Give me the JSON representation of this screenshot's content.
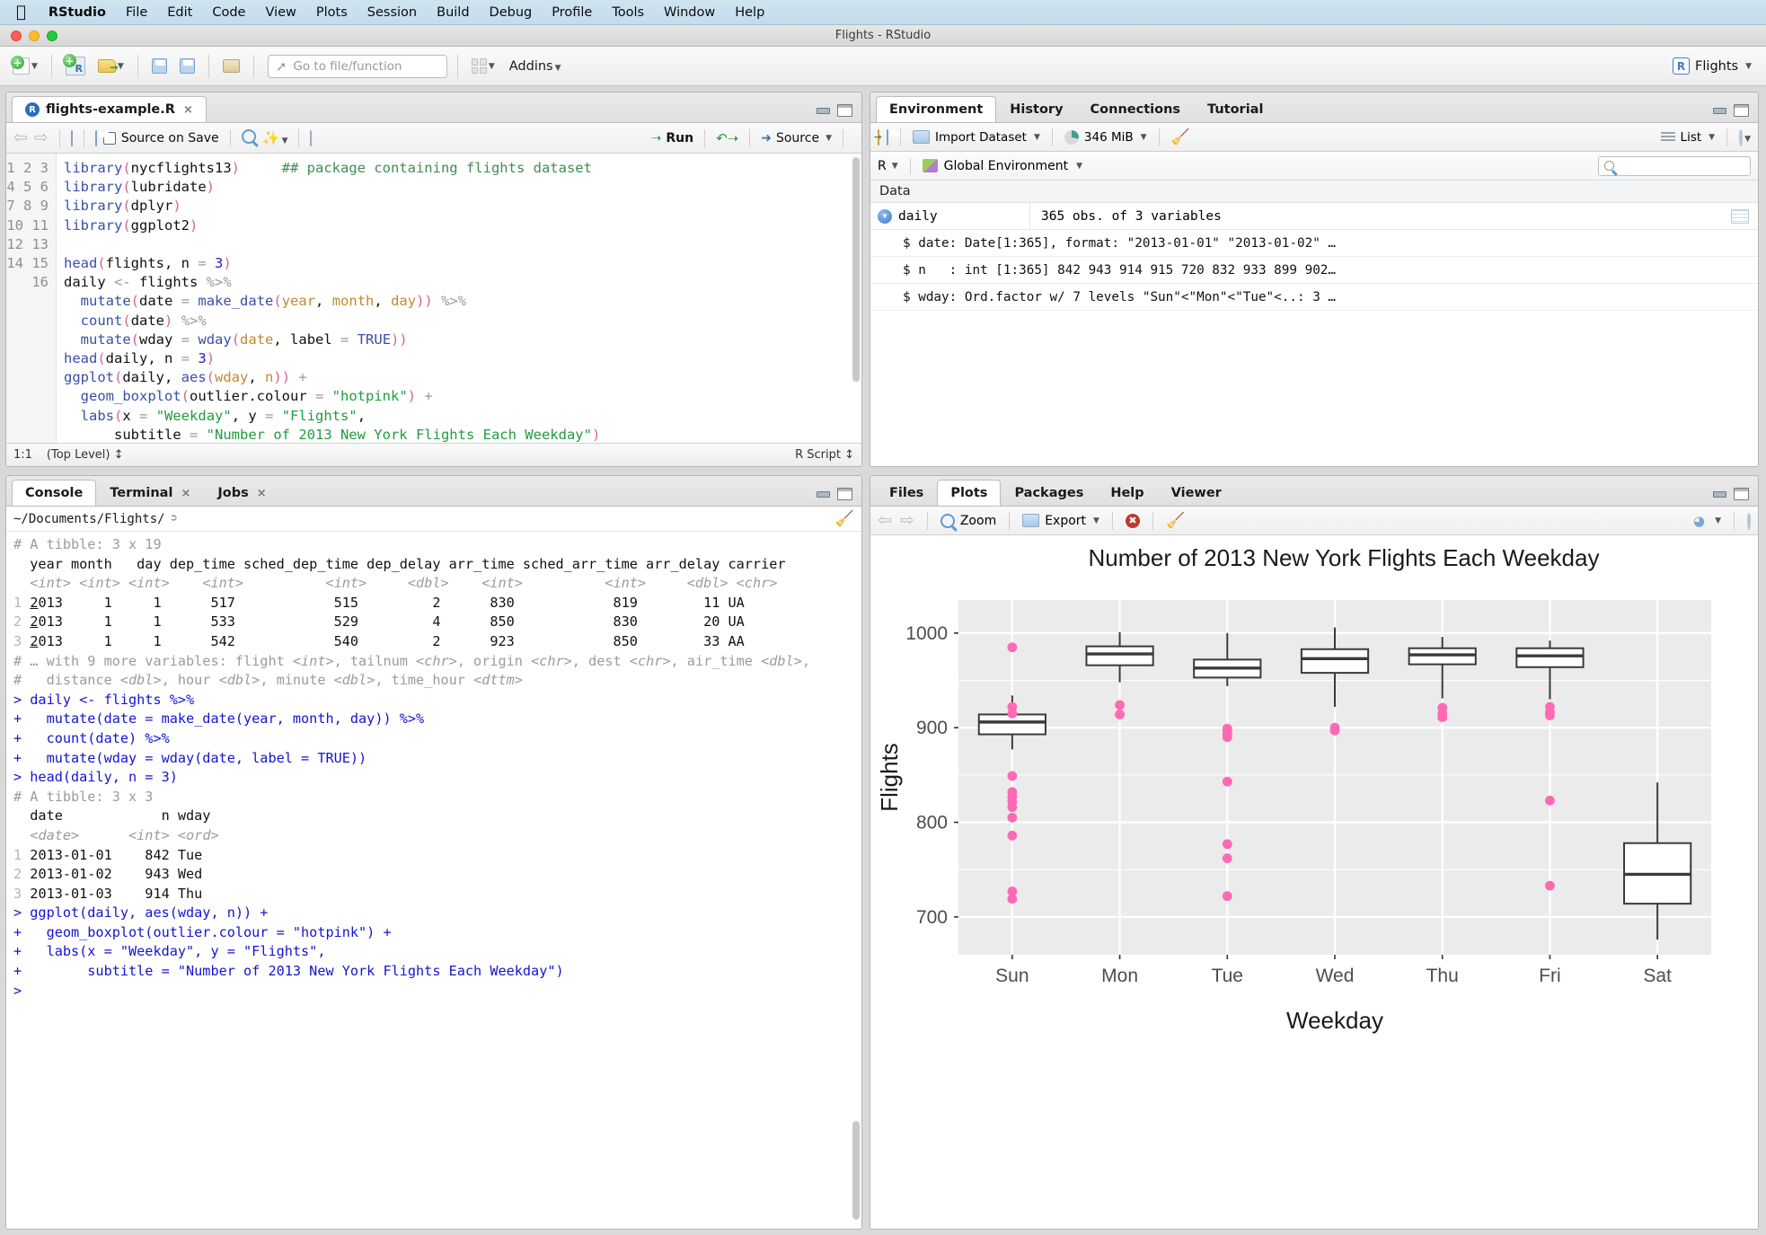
{
  "menubar": {
    "apple": "apple-logo",
    "items": [
      "RStudio",
      "File",
      "Edit",
      "Code",
      "View",
      "Plots",
      "Session",
      "Build",
      "Debug",
      "Profile",
      "Tools",
      "Window",
      "Help"
    ]
  },
  "window": {
    "title": "Flights - RStudio"
  },
  "toolbar": {
    "goto_placeholder": "Go to file/function",
    "addins": "Addins",
    "project": "Flights",
    "project_badge": "R"
  },
  "source_pane": {
    "tab": "flights-example.R",
    "tab_close": "×",
    "source_on_save": "Source on Save",
    "run": "Run",
    "source": "Source",
    "status_position": "1:1",
    "status_scope": "(Top Level) ↕",
    "status_type": "R Script ↕",
    "lines": [
      {
        "n": 1,
        "html": "<span class='k-fn'>library</span><span class='k-par'>(</span>nycflights13<span class='k-par'>)</span>     <span class='k-com'>## package containing flights dataset</span>"
      },
      {
        "n": 2,
        "html": "<span class='k-fn'>library</span><span class='k-par'>(</span>lubridate<span class='k-par'>)</span>"
      },
      {
        "n": 3,
        "html": "<span class='k-fn'>library</span><span class='k-par'>(</span>dplyr<span class='k-par'>)</span>"
      },
      {
        "n": 4,
        "html": "<span class='k-fn'>library</span><span class='k-par'>(</span>ggplot2<span class='k-par'>)</span>"
      },
      {
        "n": 5,
        "html": ""
      },
      {
        "n": 6,
        "html": "<span class='k-fn'>head</span><span class='k-par'>(</span>flights, n <span class='k-op'>=</span> <span class='k-num'>3</span><span class='k-par'>)</span>"
      },
      {
        "n": 7,
        "html": "daily <span class='k-op'>&lt;-</span> flights <span class='k-op'>%&gt;%</span>"
      },
      {
        "n": 8,
        "html": "  <span class='k-fn'>mutate</span><span class='k-par'>(</span><span class='k-id'>date</span> <span class='k-op'>=</span> <span class='k-fn'>make_date</span><span class='k-par'>(</span><span class='k-arg'>year</span>, <span class='k-arg'>month</span>, <span class='k-arg'>day</span><span class='k-par'>))</span> <span class='k-op'>%&gt;%</span>"
      },
      {
        "n": 9,
        "html": "  <span class='k-fn'>count</span><span class='k-par'>(</span><span class='k-id'>date</span><span class='k-par'>)</span> <span class='k-op'>%&gt;%</span>"
      },
      {
        "n": 10,
        "html": "  <span class='k-fn'>mutate</span><span class='k-par'>(</span><span class='k-id'>wday</span> <span class='k-op'>=</span> <span class='k-fn'>wday</span><span class='k-par'>(</span><span class='k-arg'>date</span>, label <span class='k-op'>=</span> <span class='k-kw'>TRUE</span><span class='k-par'>))</span>"
      },
      {
        "n": 11,
        "html": "<span class='k-fn'>head</span><span class='k-par'>(</span>daily, n <span class='k-op'>=</span> <span class='k-num'>3</span><span class='k-par'>)</span>"
      },
      {
        "n": 12,
        "html": "<span class='k-fn'>ggplot</span><span class='k-par'>(</span>daily, <span class='k-fn'>aes</span><span class='k-par'>(</span><span class='k-arg'>wday</span>, <span class='k-arg'>n</span><span class='k-par'>))</span> <span class='k-op'>+</span>"
      },
      {
        "n": 13,
        "html": "  <span class='k-fn'>geom_boxplot</span><span class='k-par'>(</span>outlier.colour <span class='k-op'>=</span> <span class='k-str'>\"hotpink\"</span><span class='k-par'>)</span> <span class='k-op'>+</span>"
      },
      {
        "n": 14,
        "html": "  <span class='k-fn'>labs</span><span class='k-par'>(</span>x <span class='k-op'>=</span> <span class='k-str'>\"Weekday\"</span>, y <span class='k-op'>=</span> <span class='k-str'>\"Flights\"</span>,"
      },
      {
        "n": 15,
        "html": "      subtitle <span class='k-op'>=</span> <span class='k-str'>\"Number of 2013 New York Flights Each Weekday\"</span><span class='k-par'>)</span>"
      },
      {
        "n": 16,
        "html": ""
      }
    ]
  },
  "console_pane": {
    "tabs": [
      "Console",
      "Terminal",
      "Jobs"
    ],
    "active_tab": "Console",
    "path": "~/Documents/Flights/",
    "lines": [
      {
        "html": "<span class='c-dim'># A tibble: 3 x 19</span>"
      },
      {
        "html": "  year month   day dep_time sched_dep_time dep_delay arr_time sched_arr_time arr_delay carrier"
      },
      {
        "html": "  <span class='c-it'>&lt;int&gt; &lt;int&gt; &lt;int&gt;    &lt;int&gt;          &lt;int&gt;     &lt;dbl&gt;    &lt;int&gt;          &lt;int&gt;     &lt;dbl&gt; &lt;chr&gt;</span>"
      },
      {
        "html": "<span class='c-idx'>1</span> <u>2</u>013     1     1      517            515         2      830            819        11 UA"
      },
      {
        "html": "<span class='c-idx'>2</span> <u>2</u>013     1     1      533            529         4      850            830        20 UA"
      },
      {
        "html": "<span class='c-idx'>3</span> <u>2</u>013     1     1      542            540         2      923            850        33 AA"
      },
      {
        "html": "<span class='c-dim'># … with 9 more variables: flight <i>&lt;int&gt;</i>, tailnum <i>&lt;chr&gt;</i>, origin <i>&lt;chr&gt;</i>, dest <i>&lt;chr&gt;</i>, air_time <i>&lt;dbl&gt;</i>,</span>"
      },
      {
        "html": "<span class='c-dim'>#   distance <i>&lt;dbl&gt;</i>, hour <i>&lt;dbl&gt;</i>, minute <i>&lt;dbl&gt;</i>, time_hour <i>&lt;dttm&gt;</i></span>"
      },
      {
        "html": "<span class='c-cmd'>&gt; daily &lt;- flights %&gt;%</span>"
      },
      {
        "html": "<span class='c-cmd'>+   mutate(date = make_date(year, month, day)) %&gt;%</span>"
      },
      {
        "html": "<span class='c-cmd'>+   count(date) %&gt;%</span>"
      },
      {
        "html": "<span class='c-cmd'>+   mutate(wday = wday(date, label = TRUE))</span>"
      },
      {
        "html": "<span class='c-cmd'>&gt; head(daily, n = 3)</span>"
      },
      {
        "html": "<span class='c-dim'># A tibble: 3 x 3</span>"
      },
      {
        "html": "  date            n wday"
      },
      {
        "html": "  <span class='c-it'>&lt;date&gt;      &lt;int&gt; &lt;ord&gt;</span>"
      },
      {
        "html": "<span class='c-idx'>1</span> 2013-01-01    842 Tue"
      },
      {
        "html": "<span class='c-idx'>2</span> 2013-01-02    943 Wed"
      },
      {
        "html": "<span class='c-idx'>3</span> 2013-01-03    914 Thu"
      },
      {
        "html": "<span class='c-cmd'>&gt; ggplot(daily, aes(wday, n)) +</span>"
      },
      {
        "html": "<span class='c-cmd'>+   geom_boxplot(outlier.colour = \"hotpink\") +</span>"
      },
      {
        "html": "<span class='c-cmd'>+   labs(x = \"Weekday\", y = \"Flights\",</span>"
      },
      {
        "html": "<span class='c-cmd'>+        subtitle = \"Number of 2013 New York Flights Each Weekday\")</span>"
      },
      {
        "html": "<span class='c-cmd'>&gt; </span>"
      }
    ]
  },
  "environment_pane": {
    "tabs": [
      "Environment",
      "History",
      "Connections",
      "Tutorial"
    ],
    "active_tab": "Environment",
    "import_dataset": "Import Dataset",
    "memory": "346 MiB",
    "view_mode": "List",
    "language": "R",
    "scope": "Global Environment",
    "search_placeholder": "",
    "section_label": "Data",
    "objects": [
      {
        "name": "daily",
        "summary": "365 obs. of 3 variables",
        "fields": [
          "$ date: Date[1:365], format: \"2013-01-01\" \"2013-01-02\" …",
          "$ n   : int [1:365] 842 943 914 915 720 832 933 899 902…",
          "$ wday: Ord.factor w/ 7 levels \"Sun\"<\"Mon\"<\"Tue\"<..: 3 …"
        ]
      }
    ]
  },
  "plots_pane": {
    "tabs": [
      "Files",
      "Plots",
      "Packages",
      "Help",
      "Viewer"
    ],
    "active_tab": "Plots",
    "zoom": "Zoom",
    "export": "Export"
  },
  "chart_data": {
    "type": "boxplot",
    "title": "Number of 2013 New York Flights Each Weekday",
    "xlabel": "Weekday",
    "ylabel": "Flights",
    "categories": [
      "Sun",
      "Mon",
      "Tue",
      "Wed",
      "Thu",
      "Fri",
      "Sat"
    ],
    "yticks": [
      700,
      800,
      900,
      1000
    ],
    "ylim": [
      660,
      1035
    ],
    "grid": true,
    "outlier_colour": "#ff69b4",
    "panel_bg": "#ebebeb",
    "boxes": [
      {
        "cat": "Sun",
        "lower_whisker": 877,
        "q1": 893,
        "median": 906,
        "q3": 914,
        "upper_whisker": 934,
        "outliers": [
          985,
          915,
          922,
          849,
          832,
          827,
          822,
          816,
          805,
          786,
          727,
          719
        ]
      },
      {
        "cat": "Mon",
        "lower_whisker": 948,
        "q1": 966,
        "median": 978,
        "q3": 986,
        "upper_whisker": 1001,
        "outliers": [
          924,
          914
        ]
      },
      {
        "cat": "Tue",
        "lower_whisker": 944,
        "q1": 953,
        "median": 963,
        "q3": 972,
        "upper_whisker": 1000,
        "outliers": [
          899,
          897,
          893,
          890,
          843,
          777,
          762,
          722
        ]
      },
      {
        "cat": "Wed",
        "lower_whisker": 922,
        "q1": 958,
        "median": 973,
        "q3": 983,
        "upper_whisker": 1006,
        "outliers": [
          900,
          897
        ]
      },
      {
        "cat": "Thu",
        "lower_whisker": 931,
        "q1": 967,
        "median": 977,
        "q3": 984,
        "upper_whisker": 996,
        "outliers": [
          921,
          915,
          911
        ]
      },
      {
        "cat": "Fri",
        "lower_whisker": 930,
        "q1": 964,
        "median": 976,
        "q3": 984,
        "upper_whisker": 992,
        "outliers": [
          922,
          916,
          913,
          823,
          733
        ]
      },
      {
        "cat": "Sat",
        "lower_whisker": 676,
        "q1": 714,
        "median": 745,
        "q3": 778,
        "upper_whisker": 842,
        "outliers": []
      }
    ]
  }
}
